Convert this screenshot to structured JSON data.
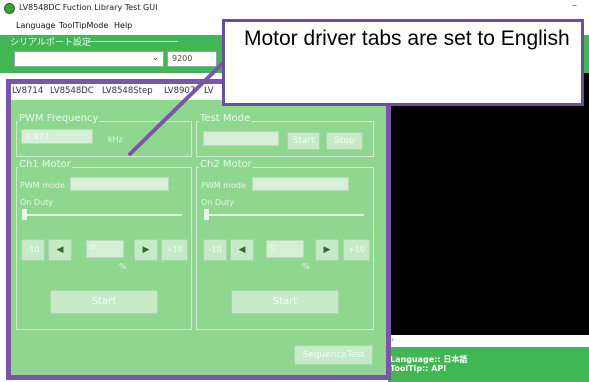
{
  "window": {
    "title": "LV8548DC Fuction Library Test GUI",
    "minimize": "–"
  },
  "menu": [
    "Language",
    "ToolTipMode",
    "Help"
  ],
  "serial": {
    "legend": "シリアルポート設定",
    "port_value": "",
    "baud_value": "9200"
  },
  "tabs": [
    "LV8714",
    "LV8548DC",
    "LV8548Step",
    "LV8907",
    "LV"
  ],
  "pwm_frequency": {
    "title": "PWM Frequency",
    "value": "0.977",
    "unit": "kHz"
  },
  "test_mode": {
    "title": "Test Mode",
    "start": "Start",
    "stop": "Stop"
  },
  "ch1": {
    "title": "Ch1 Motor",
    "pwm_mode_label": "PWM mode",
    "on_duty_label": "On Duty",
    "minus10": "-10",
    "value": "0",
    "percent": "%",
    "plus10": "+10",
    "start": "Start"
  },
  "ch2": {
    "title": "Ch2 Motor",
    "pwm_mode_label": "PWM mode",
    "on_duty_label": "On Duty",
    "minus10": "-10",
    "value": "0",
    "percent": "%",
    "plus10": "+10",
    "start": "Start"
  },
  "sequence_test": "SequenceTest",
  "status": {
    "language": "Language:: 日本語",
    "tooltip": "ToolTip::     API"
  },
  "callout": "Motor driver tabs are set to English"
}
